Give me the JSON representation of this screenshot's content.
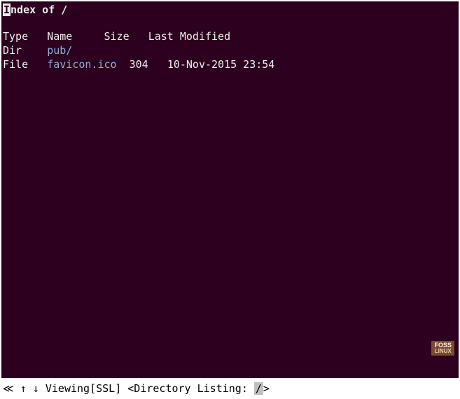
{
  "title": {
    "prefix_char": "I",
    "rest": "ndex of /"
  },
  "columns": {
    "type": "Type",
    "name": "Name",
    "size": "Size",
    "modified": "Last Modified"
  },
  "entries": [
    {
      "type": "Dir",
      "name": "pub/",
      "size": "",
      "modified": "",
      "is_link": true
    },
    {
      "type": "File",
      "name": "favicon.ico",
      "size": "304",
      "modified": "10-Nov-2015 23:54",
      "is_link": true
    }
  ],
  "status": {
    "nav_symbols": "≪ ↑ ↓ ",
    "viewing": "Viewing",
    "ssl": "[SSL]",
    "listing_prefix": " <Directory Listing: ",
    "path": "/",
    "listing_suffix": ">"
  },
  "watermark": {
    "line1": "FOSS",
    "line2": "LINUX"
  }
}
